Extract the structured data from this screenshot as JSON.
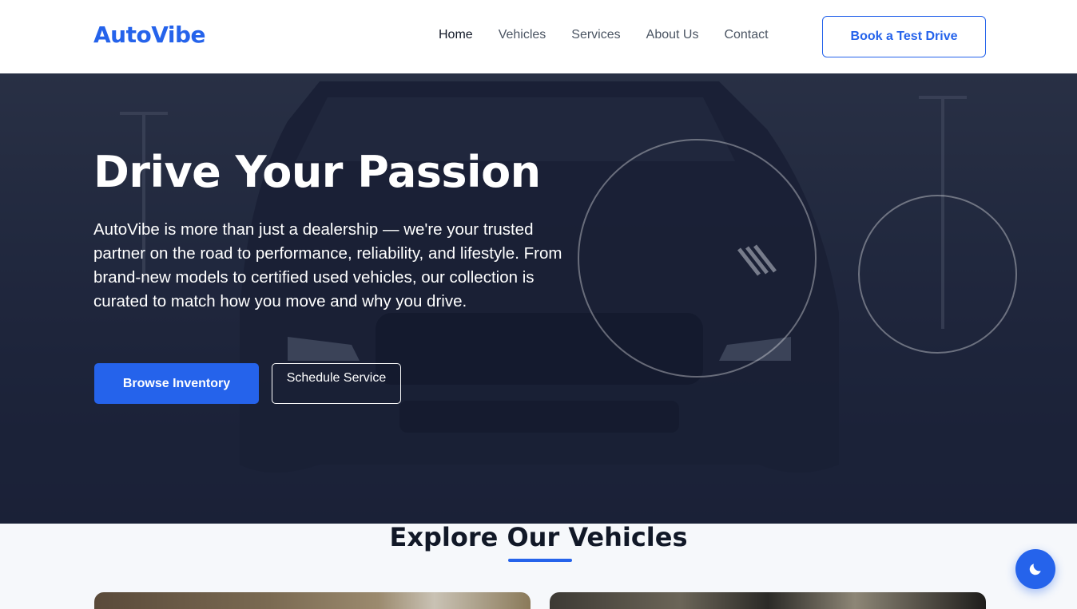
{
  "header": {
    "logo": "AutoVibe",
    "nav": [
      {
        "label": "Home",
        "active": true
      },
      {
        "label": "Vehicles",
        "active": false
      },
      {
        "label": "Services",
        "active": false
      },
      {
        "label": "About Us",
        "active": false
      },
      {
        "label": "Contact",
        "active": false
      }
    ],
    "cta_label": "Book a Test Drive"
  },
  "hero": {
    "title": "Drive Your Passion",
    "text": "AutoVibe is more than just a dealership — we're your trusted partner on the road to performance, reliability, and lifestyle. From brand-new models to certified used vehicles, our collection is curated to match how you move and why you drive.",
    "primary_button": "Browse Inventory",
    "secondary_button": "Schedule Service",
    "background_image": "car-front-icon"
  },
  "vehicles": {
    "title": "Explore Our Vehicles"
  },
  "theme_toggle": {
    "icon": "moon-icon"
  },
  "colors": {
    "accent": "#2563eb",
    "heading": "#111827",
    "nav_text": "#4b5563",
    "hero_overlay": "#1d2338"
  }
}
